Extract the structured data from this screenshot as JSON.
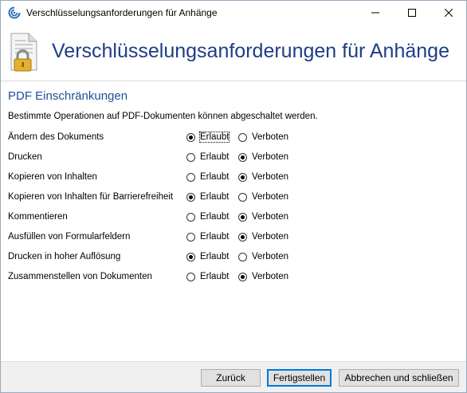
{
  "window": {
    "title": "Verschlüsselungsanforderungen für Anhänge"
  },
  "header": {
    "title": "Verschlüsselungsanforderungen für Anhänge",
    "icon": "document-lock-icon"
  },
  "section": {
    "title": "PDF Einschränkungen",
    "description": "Bestimmte Operationen auf PDF-Dokumenten können abgeschaltet werden."
  },
  "options": {
    "allow_label": "Erlaubt",
    "deny_label": "Verboten"
  },
  "rows": [
    {
      "label": "Ändern des Dokuments",
      "selected": "Erlaubt"
    },
    {
      "label": "Drucken",
      "selected": "Verboten"
    },
    {
      "label": "Kopieren von Inhalten",
      "selected": "Verboten"
    },
    {
      "label": "Kopieren von Inhalten für Barrierefreiheit",
      "selected": "Erlaubt"
    },
    {
      "label": "Kommentieren",
      "selected": "Verboten"
    },
    {
      "label": "Ausfüllen von Formularfeldern",
      "selected": "Verboten"
    },
    {
      "label": "Drucken in hoher Auflösung",
      "selected": "Erlaubt"
    },
    {
      "label": "Zusammenstellen von Dokumenten",
      "selected": "Verboten"
    }
  ],
  "footer": {
    "back_label": "Zurück",
    "finish_label": "Fertigstellen",
    "cancel_label": "Abbrechen und schließen"
  },
  "colors": {
    "header_title": "#1f3d86",
    "section_title": "#1f4e99",
    "default_button_border": "#0078d7"
  }
}
